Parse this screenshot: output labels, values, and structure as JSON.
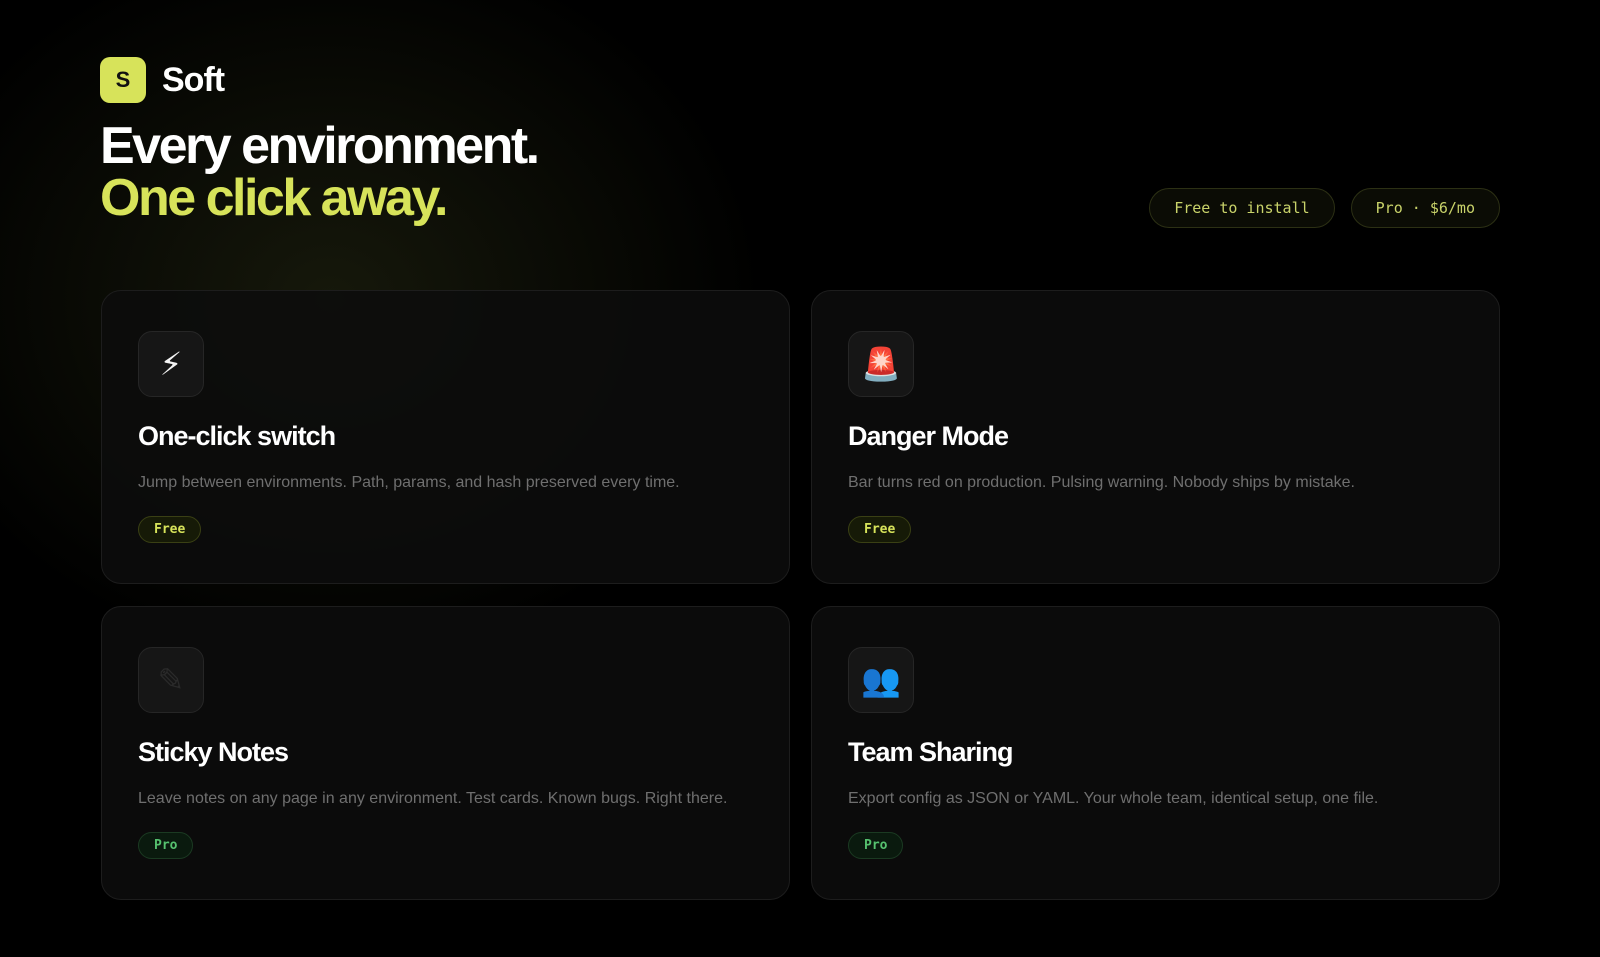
{
  "brand": {
    "initial": "S",
    "name": "Soft",
    "accent_color": "#d7e35a"
  },
  "hero": {
    "line1": "Every environment.",
    "line2": "One click away."
  },
  "pills": [
    {
      "label": "Free to install"
    },
    {
      "label": "Pro · $6/mo"
    }
  ],
  "features": [
    {
      "icon": "⚡",
      "icon_name": "lightning-icon",
      "title": "One-click switch",
      "description": "Jump between environments. Path, params, and hash preserved every time.",
      "tier": "Free"
    },
    {
      "icon": "🚨",
      "icon_name": "siren-icon",
      "title": "Danger Mode",
      "description": "Bar turns red on production. Pulsing warning. Nobody ships by mistake.",
      "tier": "Free"
    },
    {
      "icon": "✎",
      "icon_name": "pencil-icon",
      "title": "Sticky Notes",
      "description": "Leave notes on any page in any environment. Test cards. Known bugs. Right there.",
      "tier": "Pro"
    },
    {
      "icon": "👥",
      "icon_name": "team-icon",
      "title": "Team Sharing",
      "description": "Export config as JSON or YAML. Your whole team, identical setup, one file.",
      "tier": "Pro"
    }
  ]
}
